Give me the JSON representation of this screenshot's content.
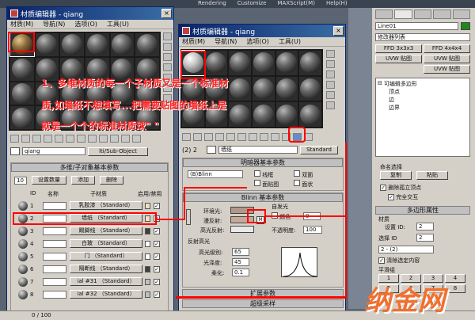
{
  "top_menu": {
    "items": [
      "Rendering",
      "Customize",
      "MAXScript(M)",
      "Help(H)"
    ]
  },
  "left_editor": {
    "title": "材质编辑器 - qiang",
    "menu": [
      "材质(M)",
      "导航(N)",
      "选项(O)",
      "工具(U)"
    ],
    "material_name": "qiang",
    "material_type": "lti/Sub-Object",
    "rollout_title": "多维/子对象基本参数",
    "set_count_value": "10",
    "set_count_label": "设置数量",
    "add_label": "添加",
    "delete_label": "删除",
    "col_id": "ID",
    "col_name": "名称",
    "col_sub": "子材质",
    "col_enable": "启用/禁用",
    "rows": [
      {
        "id": "1",
        "name": "",
        "sub": "乳胶漆 （Standard）"
      },
      {
        "id": "2",
        "name": "",
        "sub": "墙纸 （Standard）"
      },
      {
        "id": "3",
        "name": "",
        "sub": "踢脚线 （Standard）"
      },
      {
        "id": "4",
        "name": "",
        "sub": "白玻 （Standard）"
      },
      {
        "id": "5",
        "name": "",
        "sub": "门 （Standard）"
      },
      {
        "id": "6",
        "name": "",
        "sub": "隔断线 （Standard）"
      },
      {
        "id": "7",
        "name": "",
        "sub": "ial #31 （Standard）"
      },
      {
        "id": "8",
        "name": "",
        "sub": "ial #32 （Standard）"
      }
    ]
  },
  "right_editor": {
    "title": "材质编辑器 - qiang",
    "menu": [
      "材质(M)",
      "导航(N)",
      "选项(O)",
      "工具(U)"
    ],
    "slot_label": "(2) 2",
    "material_name": "墙纸",
    "material_type": "Standard",
    "shader_rollout": "明暗器基本参数",
    "shader_value": "(B)Blinn",
    "opt_wire": "线框",
    "opt_twosided": "双面",
    "opt_facemap": "面贴图",
    "opt_faceted": "面状",
    "blinn_rollout": "Blinn 基本参数",
    "self_illum": "自发光",
    "color_label": "颜色",
    "color_value": "0",
    "ambient": "环境光:",
    "diffuse": "漫反射:",
    "specular": "高光反射:",
    "opacity_label": "不透明度:",
    "opacity_value": "100",
    "spec_hl_title": "反射高光",
    "spec_level_label": "高光级别:",
    "spec_level": "65",
    "gloss_label": "光泽度:",
    "gloss": "45",
    "soften_label": "柔化:",
    "soften": "0.1",
    "ext_rollout": "扩展参数",
    "ss_rollout": "超级采样",
    "diffuse_btn": "M"
  },
  "annotation": {
    "lines": [
      "1、多维材质的每一个子材质又是一个标准材",
      "质,如墙纸不想填写...把需要贴图的墙纸上是",
      "就是一个个的标准材质球\" \""
    ]
  },
  "command_panel": {
    "object_name": "Line01",
    "modifier_list": "修改器列表",
    "btn_ffd3": "FFD 3x3x3",
    "btn_ffd4": "FFD 4x4x4",
    "btn_uvw": "UVW 贴图",
    "btn_uvw2": "UVW 贴图",
    "btn_uvw3": "UVW 贴图",
    "stack_top": "可编辑多边形",
    "stack_items": [
      "顶点",
      "边",
      "边界"
    ],
    "naming": "命名选择",
    "copy": "复制",
    "paste": "粘贴",
    "delete_iso": "删除孤立顶点",
    "full_interop": "完全交互",
    "poly_props": "多边形属性",
    "material": "材质",
    "set_id_label": "设置 ID:",
    "set_id": "2",
    "select_id_label": "选择 ID",
    "select_id": "2",
    "select_dropdown": "2 - (2)",
    "clear_sel": "清除选定内容",
    "smooth_group": "平滑组",
    "smooth_nums": [
      "1",
      "2",
      "3",
      "4",
      "5",
      "6",
      "7",
      "8"
    ]
  },
  "status": {
    "frame": "0 / 100"
  },
  "watermark": "纳金网"
}
